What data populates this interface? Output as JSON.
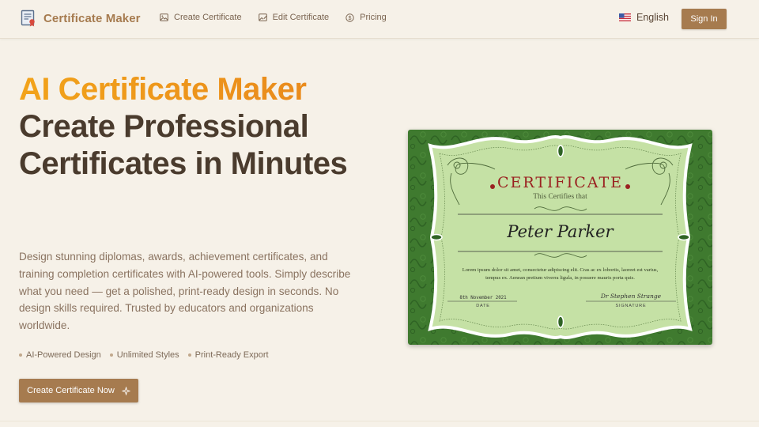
{
  "nav": {
    "brand": "Certificate Maker",
    "links": [
      {
        "label": "Create Certificate",
        "icon": "image-icon"
      },
      {
        "label": "Edit Certificate",
        "icon": "edit-image-icon"
      },
      {
        "label": "Pricing",
        "icon": "dollar-circle-icon"
      }
    ],
    "language": "English",
    "sign_in": "Sign In"
  },
  "hero": {
    "title_highlight": "AI Certificate Maker",
    "title_main": "Create Professional Certificates in Minutes",
    "description": "Design stunning diplomas, awards, achievement certificates, and training completion certificates with AI-powered tools. Simply describe what you need — get a polished, print-ready design in seconds. No design skills required. Trusted by educators and organizations worldwide.",
    "features": [
      "AI-Powered Design",
      "Unlimited Styles",
      "Print-Ready Export"
    ],
    "cta": "Create Certificate Now"
  },
  "certificate": {
    "title": "CERTIFICATE",
    "subtitle": "This Certifies that",
    "name": "Peter Parker",
    "body": "Lorem ipsum dolor sit amet, consectetur adipiscing elit. Cras ac ex lobortis, laoreet est varius, tempus ex. Aenean pretium viverra ligula, in posuere mauris porta quis.",
    "date": "8th November 2021",
    "date_label": "DATE",
    "signature": "Dr Stephen Strange",
    "signature_label": "SIGNATURE"
  },
  "colors": {
    "background": "#f6f1e8",
    "accent": "#a67b4f",
    "gradient_start": "#f2a31a",
    "gradient_end": "#e8871c",
    "text_dark": "#4a3b2d",
    "cert_green": "#3f7a2f",
    "cert_panel": "#c5e1a5",
    "cert_red": "#9a2121"
  }
}
